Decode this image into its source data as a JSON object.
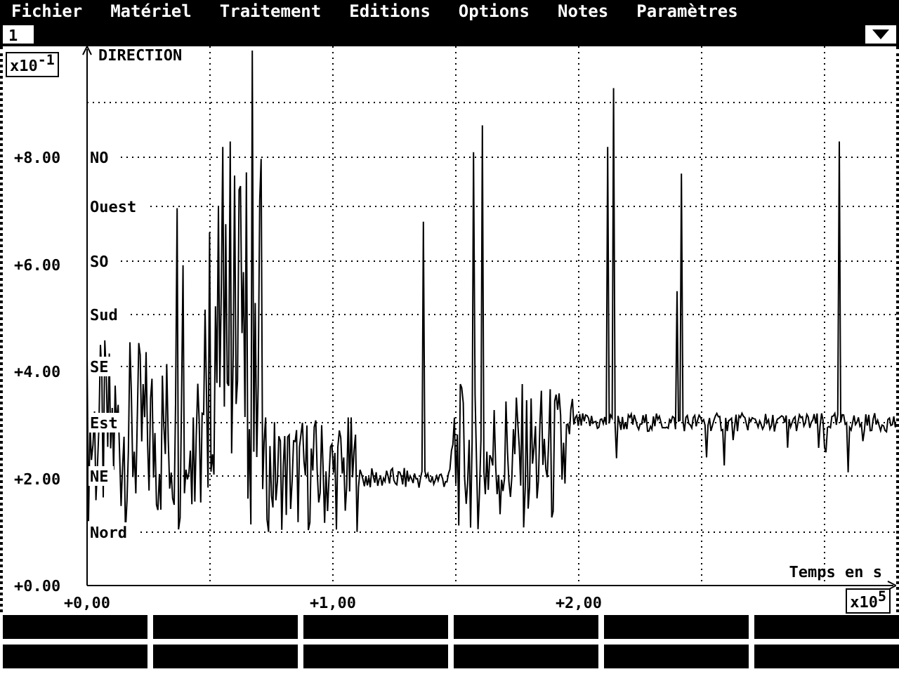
{
  "menu": [
    {
      "label": "Fichier"
    },
    {
      "label": "Matériel"
    },
    {
      "label": "Traitement"
    },
    {
      "label": "Editions"
    },
    {
      "label": "Options"
    },
    {
      "label": "Notes"
    },
    {
      "label": "Paramètres"
    }
  ],
  "tab": {
    "label": "1",
    "selected": true
  },
  "plot": {
    "title": "DIRECTION",
    "y_scale": "x10$^{-1}$",
    "x_scale": "x10$^{5}$",
    "x_label": "Temps en s",
    "y_ticks": [
      "+8.00",
      "+6.00",
      "+4.00",
      "+2.00",
      "+0.00"
    ],
    "x_ticks": [
      "+0,00",
      "+1,00",
      "+2,00"
    ],
    "direction_labels": [
      "NO",
      "Ouest",
      "SO",
      "Sud",
      "SE",
      "Est",
      "NE",
      "Nord"
    ]
  }
}
